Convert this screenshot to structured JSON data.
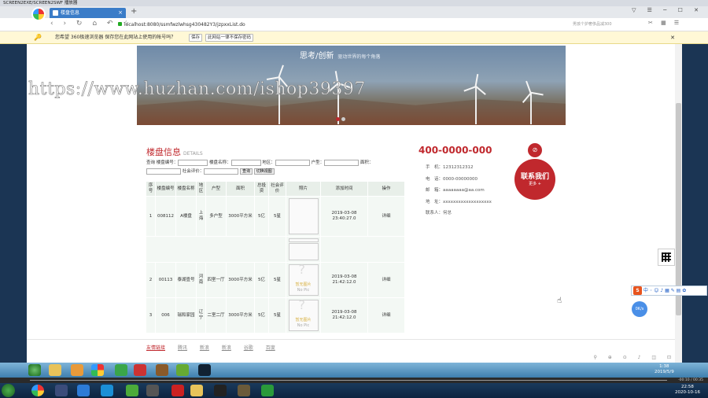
{
  "player": {
    "title": "SCREEN2EXE/SCREEN2SWF 播放器",
    "seek_text": "-00:10 / 00:35",
    "clock_time": "22:58",
    "clock_date": "2020-10-16"
  },
  "browser": {
    "tab_title": "楼盘信息",
    "url": "localhost:8080/ssmfwzlwhsg430482Y3/jzpxxList.do",
    "search_placeholder": "男孩个护奢侈品减300",
    "notice": "您希望 360极速浏览器 保存您在此网站上使用的帐号吗？",
    "notice_save": "保存",
    "notice_never": "此网站一律不保存密码"
  },
  "banner": {
    "slogan": "思考/创新",
    "slogan_sub": "驱动世界的每个角落"
  },
  "section": {
    "title": "楼盘信息",
    "subtitle": "DETAILS"
  },
  "filters": {
    "label_prefix": "查询",
    "fields": [
      "楼盘编号：",
      "楼盘名称：",
      "地区：",
      "户型：",
      "面积：",
      "社会评价："
    ],
    "query": "查询",
    "switch": "切换视图"
  },
  "table": {
    "headers": [
      "序号",
      "楼盘编号",
      "楼盘名称",
      "地区",
      "户型",
      "面积",
      "总投资",
      "社会评价",
      "照片",
      "添加时间",
      "操作"
    ],
    "rows": [
      {
        "no": "1",
        "code": "008112",
        "name": "A楼盘",
        "region": "上海",
        "type": "多户型",
        "area": "3000平方米",
        "invest": "5亿",
        "rating": "5星",
        "time": "2019-03-08 23:40:27.0",
        "op": "详细"
      },
      {
        "no": "2",
        "code": "00113",
        "name": "泰湖壹号",
        "region": "河南",
        "type": "四室一厅",
        "area": "3000平方米",
        "invest": "5亿",
        "rating": "5星",
        "time": "2019-03-08 21:42:12.0",
        "op": "详细"
      },
      {
        "no": "3",
        "code": "006",
        "name": "瑞和家园",
        "region": "辽宁",
        "type": "二室二厅",
        "area": "3000平方米",
        "invest": "5亿",
        "rating": "5星",
        "time": "2019-03-08 21:42:12.0",
        "op": "详细"
      }
    ],
    "no_pic_cn": "暂无图片",
    "no_pic_en": "No Pic"
  },
  "contact": {
    "hotline": "400-0000-000",
    "items": [
      "手　机：12312312312",
      "电　话：0000-00000000",
      "邮　箱：aaaaaaaa@aa.com",
      "地　址：xxxxxxxxxxxxxxxxxxx",
      "联系人：何总"
    ],
    "badge_title": "联系我们",
    "badge_more": "更多 +"
  },
  "footer": {
    "links": [
      "友情链接",
      "腾讯",
      "新浪",
      "新浪",
      "谷歌",
      "百度"
    ]
  },
  "inner_clock": {
    "time": "1:38",
    "date": "2019/5/9"
  },
  "speed": "0K/s",
  "watermark": "https://www.huzhan.com/ishop39397"
}
